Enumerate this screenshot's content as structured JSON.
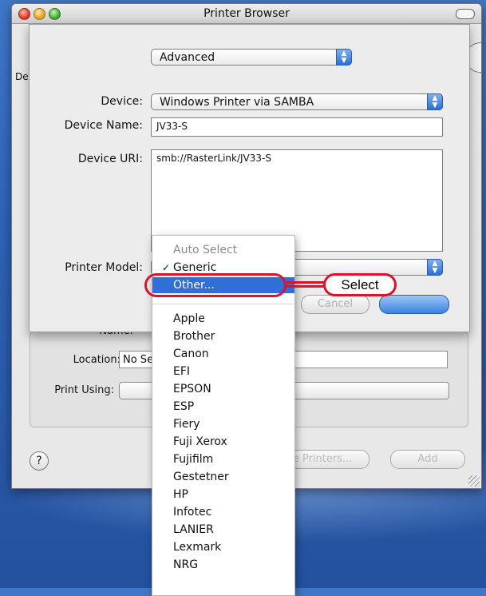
{
  "window": {
    "title": "Printer Browser",
    "left_edge_label": "De"
  },
  "sheet": {
    "mode_popup": "Advanced",
    "device_label": "Device:",
    "device_value": "Windows Printer via SAMBA",
    "device_name_label": "Device Name:",
    "device_name_value": "JV33-S",
    "device_uri_label": "Device URI:",
    "device_uri_value": "smb://RasterLink/JV33-S",
    "printer_model_label": "Printer Model:",
    "cancel_label": "Cancel",
    "add_label": "Add"
  },
  "background": {
    "name_label": "Name:",
    "location_label": "Location:",
    "location_value": "No Selection",
    "print_using_label": "Print Using:",
    "more_printers_label": "More Printers...",
    "add_label": "Add",
    "help_label": "?"
  },
  "menu": {
    "items": [
      {
        "label": "Auto Select",
        "disabled": true
      },
      {
        "label": "Generic",
        "checked": true
      },
      {
        "label": "Other...",
        "highlighted": true
      },
      {
        "label": "Apple"
      },
      {
        "label": "Brother"
      },
      {
        "label": "Canon"
      },
      {
        "label": "EFI"
      },
      {
        "label": "EPSON"
      },
      {
        "label": "ESP"
      },
      {
        "label": "Fiery"
      },
      {
        "label": "Fuji Xerox"
      },
      {
        "label": "Fujifilm"
      },
      {
        "label": "Gestetner"
      },
      {
        "label": "HP"
      },
      {
        "label": "Infotec"
      },
      {
        "label": "LANIER"
      },
      {
        "label": "Lexmark"
      },
      {
        "label": "NRG"
      }
    ]
  },
  "callout": {
    "label": "Select"
  },
  "colors": {
    "annotation": "#d9142c",
    "highlight": "#2f6fd6"
  }
}
